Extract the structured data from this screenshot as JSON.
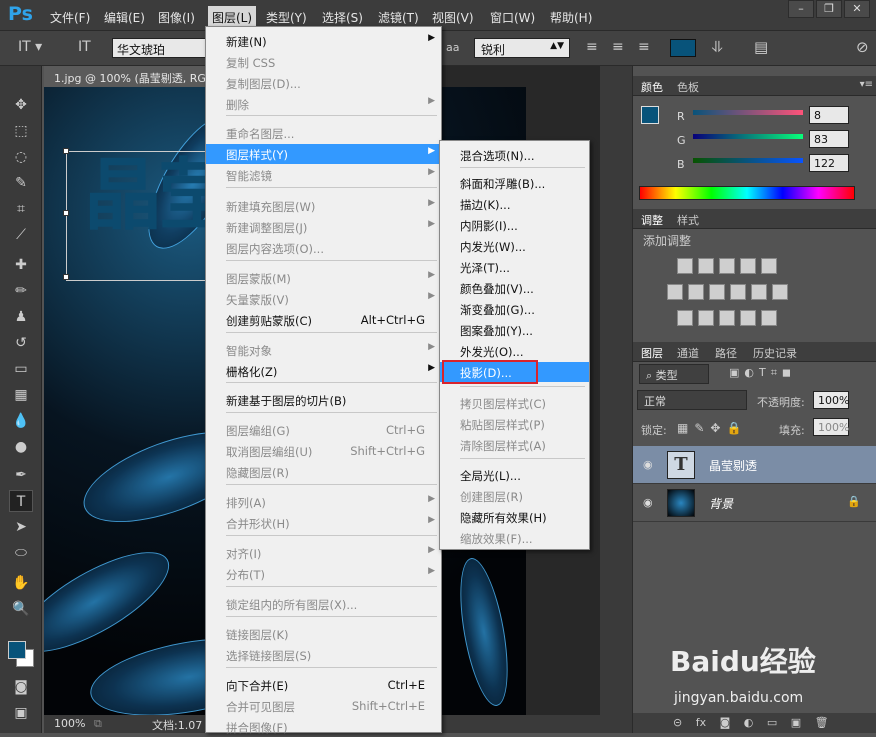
{
  "app": {
    "logo": "Ps"
  },
  "menubar": {
    "items": [
      "文件(F)",
      "编辑(E)",
      "图像(I)",
      "图层(L)",
      "类型(Y)",
      "选择(S)",
      "滤镜(T)",
      "视图(V)",
      "窗口(W)",
      "帮助(H)"
    ]
  },
  "options": {
    "font_name": "华文琥珀",
    "aa_label": "aa",
    "antialias": "锐利",
    "color": "#08537a"
  },
  "document": {
    "tab_title": "1.jpg @ 100% (晶莹剔透, RGB/8)",
    "zoom": "100%",
    "doc_label": "文档:1.07",
    "text_layer_content": "晶莹"
  },
  "layer_menu": {
    "items": [
      {
        "label": "新建(N)",
        "shortcut": "",
        "submenu": true,
        "disabled": false
      },
      {
        "label": "复制 CSS",
        "shortcut": "",
        "submenu": false,
        "disabled": true
      },
      {
        "label": "复制图层(D)...",
        "shortcut": "",
        "submenu": false,
        "disabled": true
      },
      {
        "label": "删除",
        "shortcut": "",
        "submenu": true,
        "disabled": true
      },
      {
        "label": "重命名图层...",
        "shortcut": "",
        "submenu": false,
        "disabled": true
      },
      {
        "label": "图层样式(Y)",
        "shortcut": "",
        "submenu": true,
        "disabled": false
      },
      {
        "label": "智能滤镜",
        "shortcut": "",
        "submenu": true,
        "disabled": true
      },
      {
        "label": "新建填充图层(W)",
        "shortcut": "",
        "submenu": true,
        "disabled": true
      },
      {
        "label": "新建调整图层(J)",
        "shortcut": "",
        "submenu": true,
        "disabled": true
      },
      {
        "label": "图层内容选项(O)...",
        "shortcut": "",
        "submenu": false,
        "disabled": true
      },
      {
        "label": "图层蒙版(M)",
        "shortcut": "",
        "submenu": true,
        "disabled": true
      },
      {
        "label": "矢量蒙版(V)",
        "shortcut": "",
        "submenu": true,
        "disabled": true
      },
      {
        "label": "创建剪贴蒙版(C)",
        "shortcut": "Alt+Ctrl+G",
        "submenu": false,
        "disabled": false
      },
      {
        "label": "智能对象",
        "shortcut": "",
        "submenu": true,
        "disabled": true
      },
      {
        "label": "栅格化(Z)",
        "shortcut": "",
        "submenu": true,
        "disabled": false
      },
      {
        "label": "新建基于图层的切片(B)",
        "shortcut": "",
        "submenu": false,
        "disabled": false
      },
      {
        "label": "图层编组(G)",
        "shortcut": "Ctrl+G",
        "submenu": false,
        "disabled": true
      },
      {
        "label": "取消图层编组(U)",
        "shortcut": "Shift+Ctrl+G",
        "submenu": false,
        "disabled": true
      },
      {
        "label": "隐藏图层(R)",
        "shortcut": "",
        "submenu": false,
        "disabled": true
      },
      {
        "label": "排列(A)",
        "shortcut": "",
        "submenu": true,
        "disabled": true
      },
      {
        "label": "合并形状(H)",
        "shortcut": "",
        "submenu": true,
        "disabled": true
      },
      {
        "label": "对齐(I)",
        "shortcut": "",
        "submenu": true,
        "disabled": true
      },
      {
        "label": "分布(T)",
        "shortcut": "",
        "submenu": true,
        "disabled": true
      },
      {
        "label": "锁定组内的所有图层(X)...",
        "shortcut": "",
        "submenu": false,
        "disabled": true
      },
      {
        "label": "链接图层(K)",
        "shortcut": "",
        "submenu": false,
        "disabled": true
      },
      {
        "label": "选择链接图层(S)",
        "shortcut": "",
        "submenu": false,
        "disabled": true
      },
      {
        "label": "向下合并(E)",
        "shortcut": "Ctrl+E",
        "submenu": false,
        "disabled": false
      },
      {
        "label": "合并可见图层",
        "shortcut": "Shift+Ctrl+E",
        "submenu": false,
        "disabled": true
      },
      {
        "label": "拼合图像(F)",
        "shortcut": "",
        "submenu": false,
        "disabled": true
      }
    ]
  },
  "style_menu": {
    "items": [
      {
        "label": "混合选项(N)...",
        "disabled": false
      },
      {
        "label": "斜面和浮雕(B)...",
        "disabled": false
      },
      {
        "label": "描边(K)...",
        "disabled": false
      },
      {
        "label": "内阴影(I)...",
        "disabled": false
      },
      {
        "label": "内发光(W)...",
        "disabled": false
      },
      {
        "label": "光泽(T)...",
        "disabled": false
      },
      {
        "label": "颜色叠加(V)...",
        "disabled": false
      },
      {
        "label": "渐变叠加(G)...",
        "disabled": false
      },
      {
        "label": "图案叠加(Y)...",
        "disabled": false
      },
      {
        "label": "外发光(O)...",
        "disabled": false
      },
      {
        "label": "投影(D)...",
        "disabled": false
      },
      {
        "label": "拷贝图层样式(C)",
        "disabled": true
      },
      {
        "label": "粘贴图层样式(P)",
        "disabled": true
      },
      {
        "label": "清除图层样式(A)",
        "disabled": true
      },
      {
        "label": "全局光(L)...",
        "disabled": false
      },
      {
        "label": "创建图层(R)",
        "disabled": true
      },
      {
        "label": "隐藏所有效果(H)",
        "disabled": false
      },
      {
        "label": "缩放效果(F)...",
        "disabled": true
      }
    ]
  },
  "color_panel": {
    "tabs": [
      "颜色",
      "色板"
    ],
    "r": "8",
    "g": "83",
    "b": "122",
    "r_label": "R",
    "g_label": "G",
    "b_label": "B"
  },
  "adjust_panel": {
    "tabs": [
      "调整",
      "样式"
    ],
    "subtitle": "添加调整"
  },
  "layers_panel": {
    "tabs": [
      "图层",
      "通道",
      "路径",
      "历史记录"
    ],
    "filter": "类型",
    "blend_mode": "正常",
    "opacity_label": "不透明度:",
    "opacity": "100%",
    "lock_label": "锁定:",
    "fill_label": "填充:",
    "fill": "100%",
    "layers": [
      {
        "name": "晶莹剔透",
        "type": "text"
      },
      {
        "name": "背景",
        "type": "image"
      }
    ]
  },
  "watermark": {
    "brand": "Baidu经验",
    "url": "jingyan.baidu.com"
  }
}
